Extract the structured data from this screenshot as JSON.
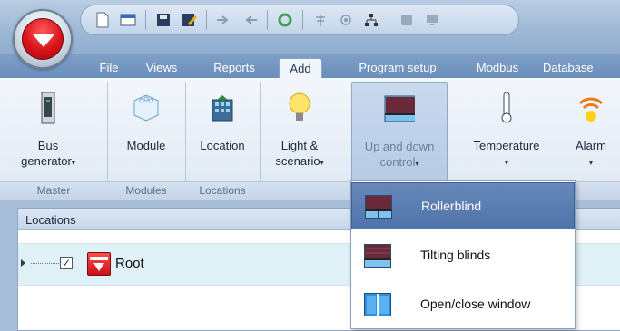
{
  "tabs": [
    "File",
    "Views",
    "Reports",
    "Add",
    "Program setup",
    "Modbus",
    "Database"
  ],
  "active_tab": "Add",
  "ribbon": {
    "buttons": [
      {
        "line1": "Bus",
        "line2": "generator",
        "has_arrow": true,
        "icon": "bus-generator-icon"
      },
      {
        "line1": "Module",
        "line2": "",
        "has_arrow": false,
        "icon": "module-icon"
      },
      {
        "line1": "Location",
        "line2": "",
        "has_arrow": false,
        "icon": "location-building-icon"
      },
      {
        "line1": "Light &",
        "line2": "scenario",
        "has_arrow": true,
        "icon": "light-bulb-icon"
      },
      {
        "line1": "Up and down",
        "line2": "control",
        "has_arrow": true,
        "icon": "blind-icon",
        "pressed": true
      },
      {
        "line1": "Temperature",
        "line2": "",
        "has_arrow": true,
        "icon": "thermometer-icon"
      },
      {
        "line1": "Alarm",
        "line2": "",
        "has_arrow": true,
        "icon": "alarm-icon"
      }
    ],
    "groups": [
      "Master",
      "Modules",
      "Locations"
    ]
  },
  "locations_panel": {
    "title": "Locations",
    "tree": [
      {
        "label": "Root",
        "checked": true,
        "icon": "carlo-gavazzi-logo-icon"
      }
    ]
  },
  "dropdown": {
    "items": [
      {
        "label": "Rollerblind",
        "icon": "rollerblind-icon",
        "selected": true
      },
      {
        "label": "Tilting blinds",
        "icon": "tilting-blinds-icon",
        "selected": false
      },
      {
        "label": "Open/close window",
        "icon": "window-icon",
        "selected": false
      }
    ]
  },
  "colors": {
    "accent_red": "#d9131c",
    "ribbon_blue": "#6a8ebc",
    "menu_selection": "#5a7db2"
  }
}
